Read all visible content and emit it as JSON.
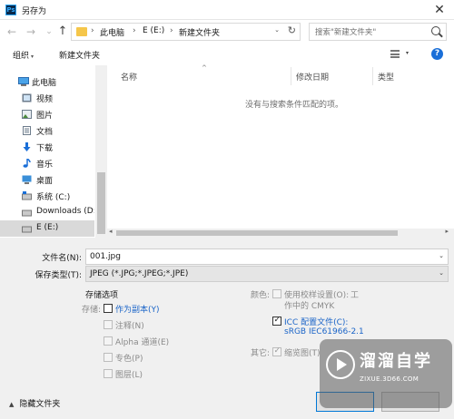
{
  "window": {
    "title": "另存为",
    "app_icon": "Ps",
    "close_glyph": "✕"
  },
  "nav": {
    "back_glyph": "←",
    "forward_glyph": "→",
    "recent_glyph": "⌄",
    "up_glyph": "↑",
    "breadcrumb": [
      "此电脑",
      "E (E:)",
      "新建文件夹"
    ],
    "separator": "›",
    "dropdown_glyph": "⌄",
    "refresh_glyph": "↻",
    "search_placeholder": "搜索\"新建文件夹\""
  },
  "toolbar": {
    "organize": "组织",
    "new_folder": "新建文件夹",
    "caret": "▾",
    "help_glyph": "?"
  },
  "sidebar": {
    "items": [
      {
        "label": "此电脑",
        "icon": "computer-icon"
      },
      {
        "label": "视频",
        "icon": "video-icon"
      },
      {
        "label": "图片",
        "icon": "picture-icon"
      },
      {
        "label": "文档",
        "icon": "document-icon"
      },
      {
        "label": "下载",
        "icon": "download-icon"
      },
      {
        "label": "音乐",
        "icon": "music-icon"
      },
      {
        "label": "桌面",
        "icon": "desktop-icon"
      },
      {
        "label": "系统 (C:)",
        "icon": "drive-c-icon"
      },
      {
        "label": "Downloads (D:",
        "icon": "drive-d-icon"
      },
      {
        "label": "E (E:)",
        "icon": "drive-e-icon"
      }
    ]
  },
  "file_list": {
    "columns": [
      "名称",
      "修改日期",
      "类型"
    ],
    "sort_glyph": "^",
    "empty_message": "没有与搜索条件匹配的项。",
    "scroll_left": "◂",
    "scroll_right": "▸"
  },
  "form": {
    "filename_label": "文件名(N):",
    "filename_value": "001.jpg",
    "filetype_label": "保存类型(T):",
    "filetype_value": "JPEG (*.JPG;*.JPEG;*.JPE)",
    "caret": "⌄"
  },
  "save_options": {
    "title": "存储选项",
    "save_label": "存储:",
    "as_copy": "作为副本(Y)",
    "notes": "注释(N)",
    "alpha": "Alpha 通道(E)",
    "spot": "专色(P)",
    "layers": "图层(L)"
  },
  "color": {
    "label": "颜色:",
    "proof_line1": "使用校样设置(O):",
    "proof_line1_suffix": "工",
    "proof_line2": "作中的 CMYK",
    "icc_line1": "ICC 配置文件(C):",
    "icc_line2": "sRGB IEC61966-2.1"
  },
  "other": {
    "label": "其它:",
    "thumbnail": "缩览图(T)"
  },
  "footer": {
    "hide_folders": "隐藏文件夹",
    "hide_caret": "▲"
  },
  "watermark": {
    "title": "溜溜自学",
    "url": "ZIXUE.3D66.COM"
  }
}
